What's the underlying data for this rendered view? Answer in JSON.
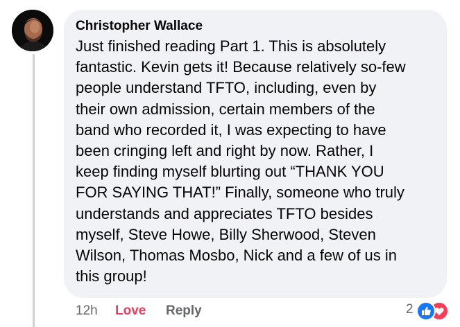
{
  "comment": {
    "author": "Christopher Wallace",
    "avatar_icon": "profile-photo",
    "lines": [
      "Just finished reading Part 1. This is absolutely",
      "fantastic. Kevin gets it! Because relatively so-few",
      "people understand TFTO, including, even by",
      "their own admission, certain members of the",
      "band who recorded it, I was expecting to have",
      "been cringing left and right by now. Rather, I",
      "keep finding myself blurting out “THANK YOU",
      "FOR SAYING THAT!” Finally, someone who truly",
      "understands and appreciates TFTO besides",
      "myself, Steve Howe, Billy Sherwood, Steven",
      "Wilson, Thomas Mosbo, Nick and a few of us in",
      "this group!"
    ]
  },
  "actions": {
    "time": "12h",
    "love_label": "Love",
    "reply_label": "Reply"
  },
  "reactions": {
    "count": "2",
    "icons": [
      "like-icon",
      "heart-icon"
    ],
    "like_color": "#1877f2",
    "heart_color": "#f33e58"
  },
  "colors": {
    "bubble": "#f0f2f5",
    "love_active": "#e4405f",
    "secondary_text": "#65676b"
  }
}
